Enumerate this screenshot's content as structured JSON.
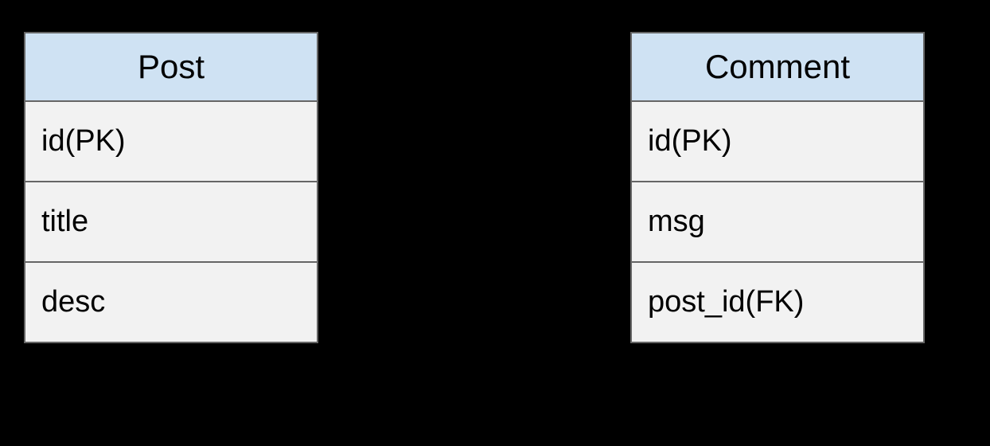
{
  "entities": {
    "post": {
      "name": "Post",
      "fields": [
        "id(PK)",
        "title",
        "desc"
      ]
    },
    "comment": {
      "name": "Comment",
      "fields": [
        "id(PK)",
        "msg",
        "post_id(FK)"
      ]
    }
  }
}
